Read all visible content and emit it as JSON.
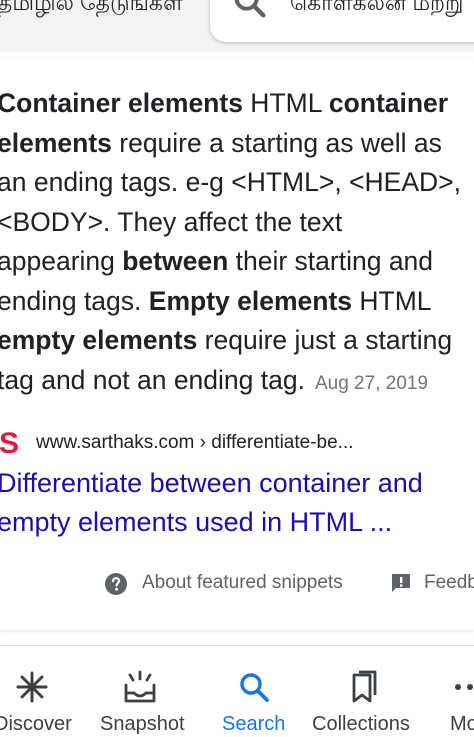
{
  "top_bar": {
    "left_text": "தமிழில் தேடுங்கள்",
    "search_text": "கொள்கலன் மற்று"
  },
  "snippet": {
    "segments": [
      {
        "t": "Container elements",
        "b": true
      },
      {
        "t": " HTML ",
        "b": false
      },
      {
        "t": "container",
        "b": true
      },
      {
        "t": "\n",
        "b": false
      },
      {
        "t": "elements",
        "b": true
      },
      {
        "t": " require a starting as well as\nan ending tags. e-g <HTML>, <HEAD>,\n<BODY>. They affect the text\nappearing ",
        "b": false
      },
      {
        "t": "between",
        "b": true
      },
      {
        "t": " their starting and\nending tags. ",
        "b": false
      },
      {
        "t": "Empty elements",
        "b": true
      },
      {
        "t": " HTML\n",
        "b": false
      },
      {
        "t": "empty elements",
        "b": true
      },
      {
        "t": " require just a starting\ntag and not an ending tag.",
        "b": false
      }
    ],
    "date": "Aug 27, 2019"
  },
  "source": {
    "favicon_letter": "S",
    "favicon_color": "#e8173d",
    "url": "www.sarthaks.com › differentiate-be..."
  },
  "result": {
    "title_line1": "Differentiate between container and",
    "title_line2": "empty elements used in HTML ...",
    "link_color": "#1a0dab"
  },
  "footer": {
    "about_label": "About featured snippets",
    "feedback_label": "Feedback",
    "about_icon": "help-circle-icon",
    "feedback_icon": "feedback-icon"
  },
  "bottom_nav": {
    "active_color": "#1a73e8",
    "items": [
      {
        "label": "Discover",
        "icon": "asterisk-icon",
        "active": false
      },
      {
        "label": "Snapshot",
        "icon": "snapshot-icon",
        "active": false
      },
      {
        "label": "Search",
        "icon": "search-icon",
        "active": true
      },
      {
        "label": "Collections",
        "icon": "bookmark-icon",
        "active": false
      },
      {
        "label": "More",
        "icon": "more-icon",
        "active": false
      }
    ]
  }
}
